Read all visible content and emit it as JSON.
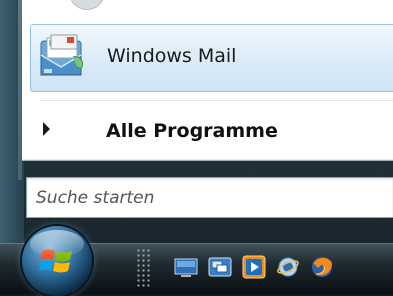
{
  "start_menu": {
    "pinned_item": {
      "label": "Windows Mail",
      "icon": "windows-mail-icon"
    },
    "all_programs": {
      "label": "Alle Programme",
      "icon": "arrow-right-icon"
    },
    "search": {
      "placeholder": "Suche starten"
    }
  },
  "taskbar": {
    "start_button": {
      "icon": "windows-orb-icon"
    },
    "quick_launch": [
      {
        "name": "show-desktop",
        "icon": "show-desktop-icon"
      },
      {
        "name": "switch-windows",
        "icon": "switch-windows-icon"
      },
      {
        "name": "media-player",
        "icon": "media-player-icon"
      },
      {
        "name": "internet-explorer",
        "icon": "internet-explorer-icon"
      },
      {
        "name": "firefox",
        "icon": "firefox-icon"
      }
    ]
  }
}
